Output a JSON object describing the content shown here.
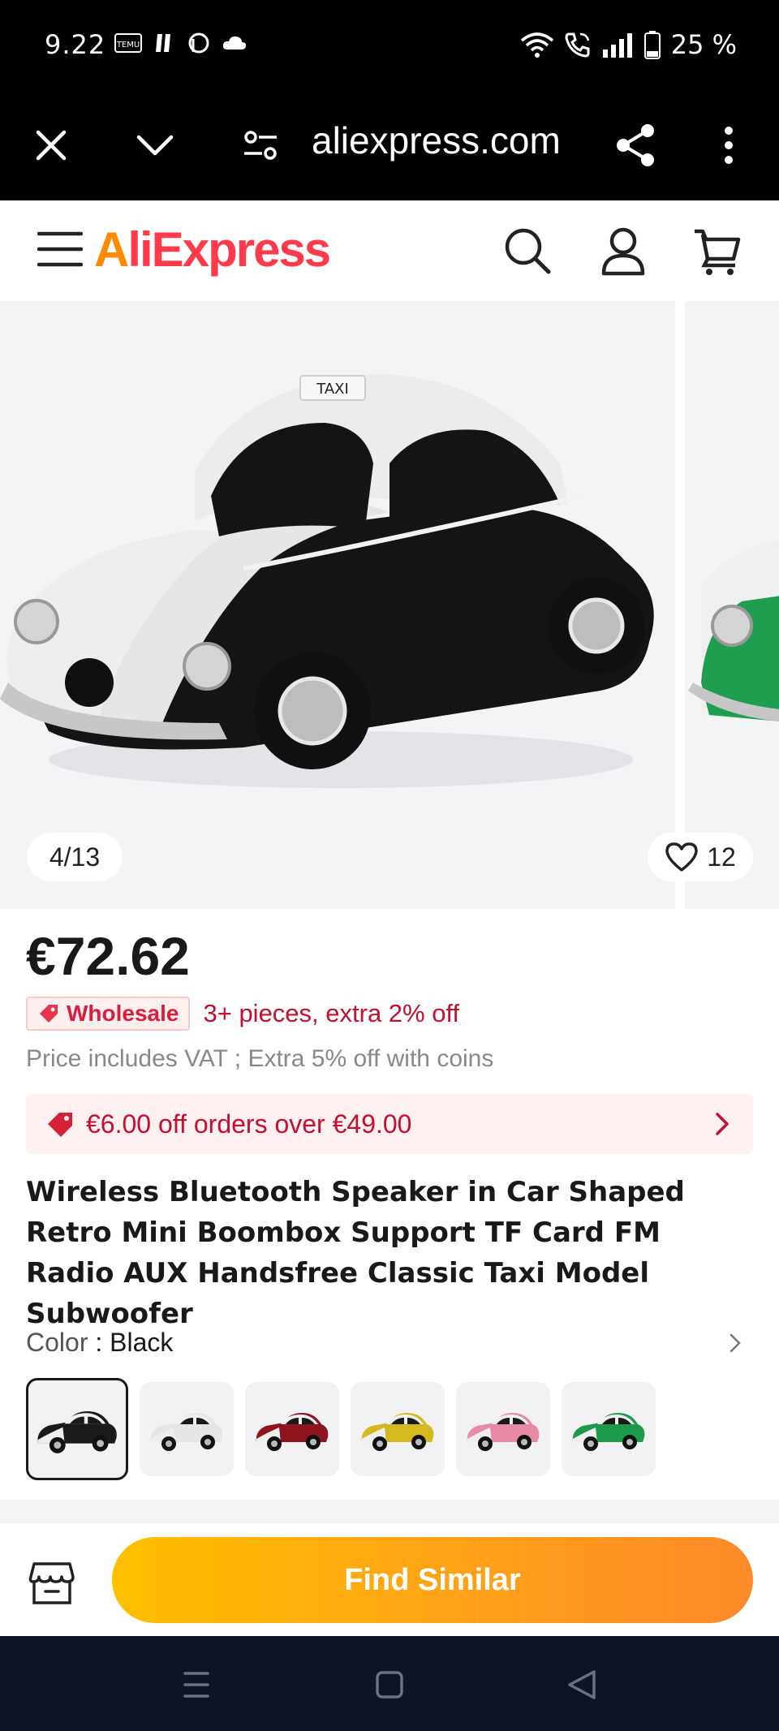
{
  "status_bar": {
    "time": "9.22",
    "battery": "25 %",
    "left_icons": [
      "temu-icon",
      "notification-icon",
      "threads-icon",
      "cloud-icon"
    ],
    "right_icons": [
      "wifi-icon",
      "wifi-call-icon",
      "signal-icon",
      "battery-icon"
    ]
  },
  "browser": {
    "url": "aliexpress.com"
  },
  "header": {
    "logo_first": "A",
    "logo_rest": "liExpress",
    "brand_colors": {
      "accent": "#ff8a00",
      "primary": "#ff3a4a"
    }
  },
  "gallery": {
    "pager": "4/13",
    "wish_count": "12"
  },
  "product": {
    "price": "€72.62",
    "wholesale_badge": "Wholesale",
    "wholesale_text": "3+ pieces, extra 2% off",
    "vat_note": "Price includes VAT ; Extra 5% off with coins",
    "coupon_text": "€6.00 off orders over €49.00",
    "title": "Wireless Bluetooth Speaker in Car Shaped Retro Mini Boombox Support TF Card FM Radio AUX Handsfree Classic Taxi Model Subwoofer",
    "color_label": "Color",
    "color_sep": " : ",
    "color_value": "Black",
    "swatches": [
      {
        "name": "black",
        "body": "#1a1a1a",
        "selected": true
      },
      {
        "name": "white",
        "body": "#e6e6e6",
        "selected": false
      },
      {
        "name": "red",
        "body": "#8e1520",
        "selected": false
      },
      {
        "name": "yellow",
        "body": "#d6b820",
        "selected": false
      },
      {
        "name": "pink",
        "body": "#e88aa6",
        "selected": false
      },
      {
        "name": "green",
        "body": "#1c9a4a",
        "selected": false
      }
    ]
  },
  "actions": {
    "find_similar": "Find Similar"
  }
}
